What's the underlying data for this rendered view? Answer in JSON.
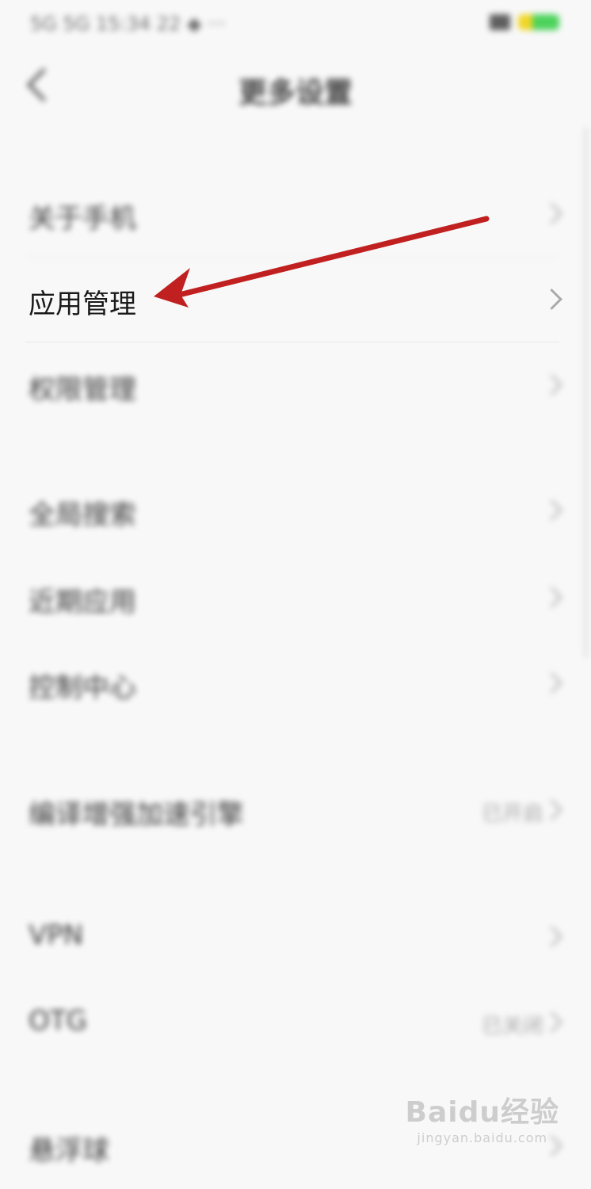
{
  "status_bar": {
    "left_text": "5G 5G 15:34 22 ◆ ···",
    "battery_colors": [
      "#f0d000",
      "#2ecc40"
    ]
  },
  "header": {
    "title": "更多设置",
    "back_icon": "chevron-left-icon"
  },
  "rows": [
    {
      "label": "关于手机",
      "value": "",
      "highlighted": false
    },
    {
      "label": "应用管理",
      "value": "",
      "highlighted": true
    },
    {
      "label": "权限管理",
      "value": "",
      "highlighted": false
    },
    {
      "label": "全局搜索",
      "value": "",
      "highlighted": false
    },
    {
      "label": "近期应用",
      "value": "",
      "highlighted": false
    },
    {
      "label": "控制中心",
      "value": "",
      "highlighted": false
    },
    {
      "label": "编译增强加速引擎",
      "value": "已开启",
      "highlighted": false
    },
    {
      "label": "VPN",
      "value": "",
      "highlighted": false
    },
    {
      "label": "OTG",
      "value": "已关闭",
      "highlighted": false
    },
    {
      "label": "悬浮球",
      "value": "",
      "highlighted": false
    }
  ],
  "annotation": {
    "arrow_color": "#c0201f",
    "target": "应用管理"
  },
  "watermark": {
    "main": "Baidu经验",
    "sub": "jingyan.baidu.com"
  }
}
